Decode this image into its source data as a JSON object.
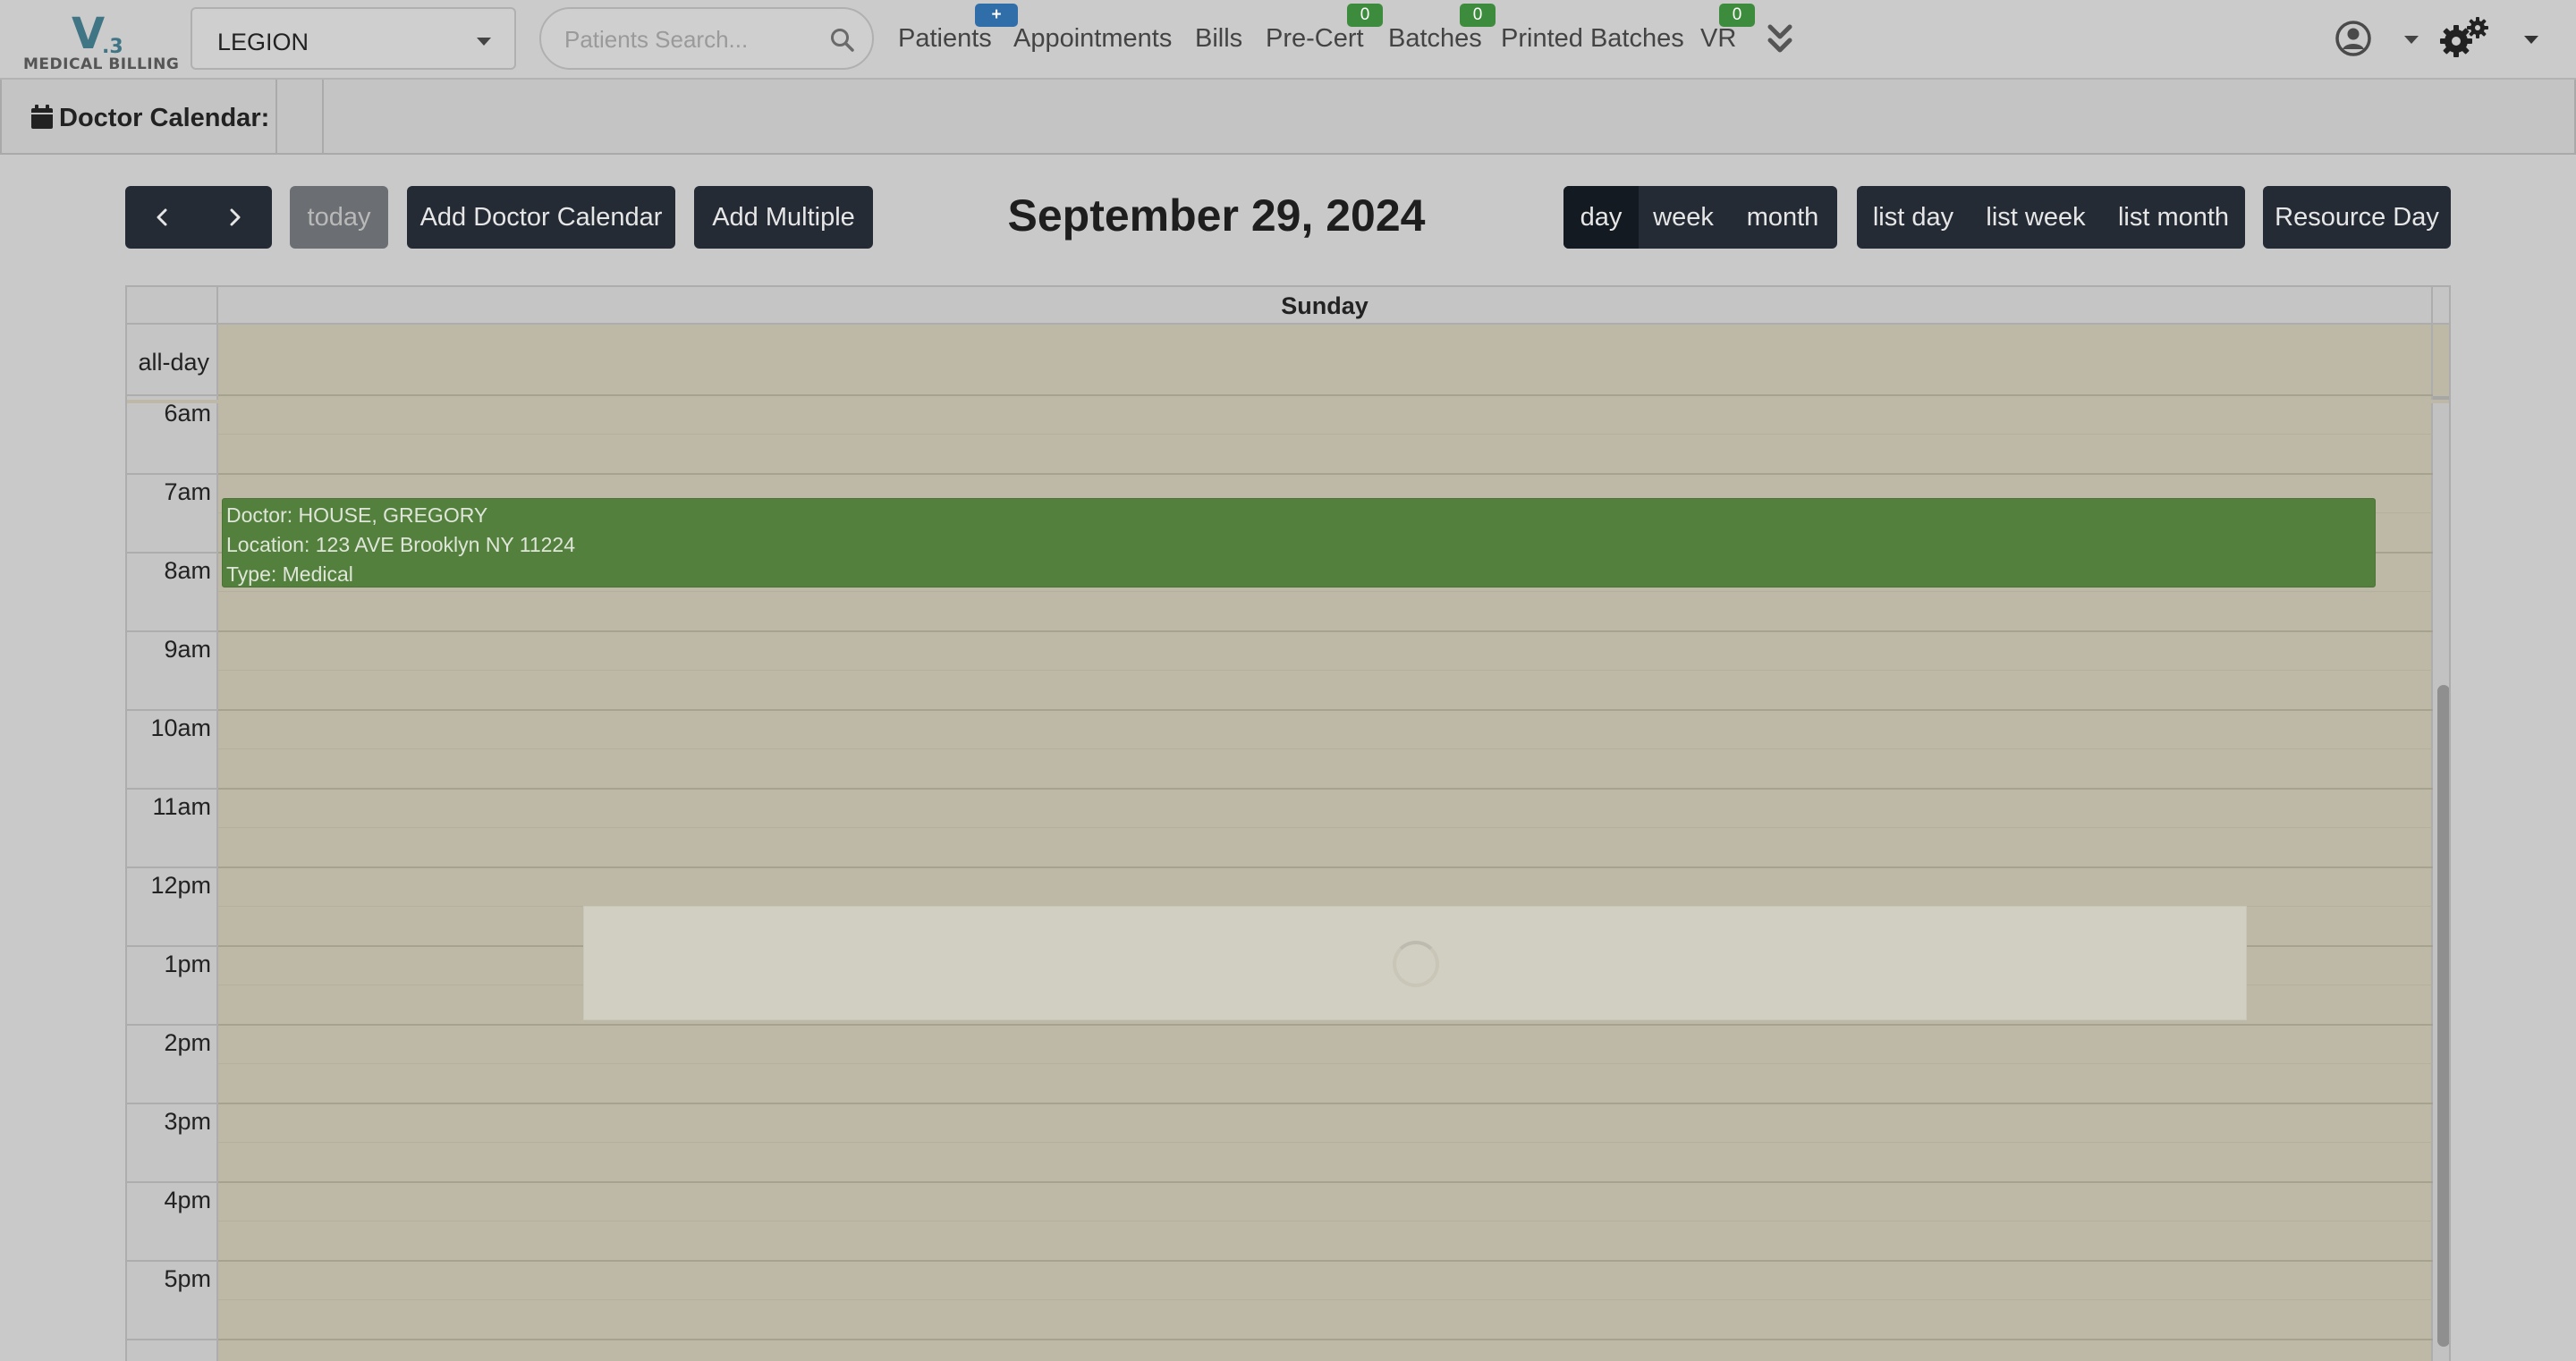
{
  "logo": {
    "mark": "V",
    "version": ".3",
    "subtitle": "MEDICAL BILLING"
  },
  "practice_select": {
    "value": "LEGION"
  },
  "search": {
    "placeholder": "Patients Search..."
  },
  "nav": {
    "patients": {
      "label": "Patients",
      "badge": "+"
    },
    "appointments": {
      "label": "Appointments"
    },
    "bills": {
      "label": "Bills"
    },
    "precert": {
      "label": "Pre-Cert",
      "badge": "0"
    },
    "batches": {
      "label": "Batches",
      "badge": "0"
    },
    "printed_batches": {
      "label": "Printed Batches"
    },
    "vr": {
      "label": "VR",
      "badge": "0"
    },
    "more_icon": "chevron-double-down-icon",
    "user_icon": "user-circle-icon",
    "settings_icon": "gears-icon"
  },
  "subheader": {
    "icon": "calendar-icon",
    "title": "Doctor Calendar:"
  },
  "toolbar": {
    "today": "today",
    "add_doctor_calendar": "Add Doctor Calendar",
    "add_multiple": "Add Multiple",
    "title": "September 29, 2024",
    "views": [
      "day",
      "week",
      "month"
    ],
    "active_view": "day",
    "list_views": [
      "list day",
      "list week",
      "list month"
    ],
    "resource_day": "Resource Day"
  },
  "calendar": {
    "day_name": "Sunday",
    "all_day_label": "all-day",
    "time_labels": [
      "6am",
      "7am",
      "8am",
      "9am",
      "10am",
      "11am",
      "12pm",
      "1pm",
      "2pm",
      "3pm",
      "4pm",
      "5pm"
    ],
    "events": [
      {
        "doctor": "Doctor: HOUSE, GREGORY",
        "location": "Location: 123 AVE Brooklyn NY 11224",
        "type": "Type: Medical"
      }
    ],
    "loading": true
  },
  "colors": {
    "nav_bg": "#cbcbcb",
    "button_dark": "#242b35",
    "event_green": "#54803e",
    "calendar_bg": "#bdb9a6",
    "badge_green": "#3d8b3d",
    "badge_blue": "#2f6ea8"
  }
}
